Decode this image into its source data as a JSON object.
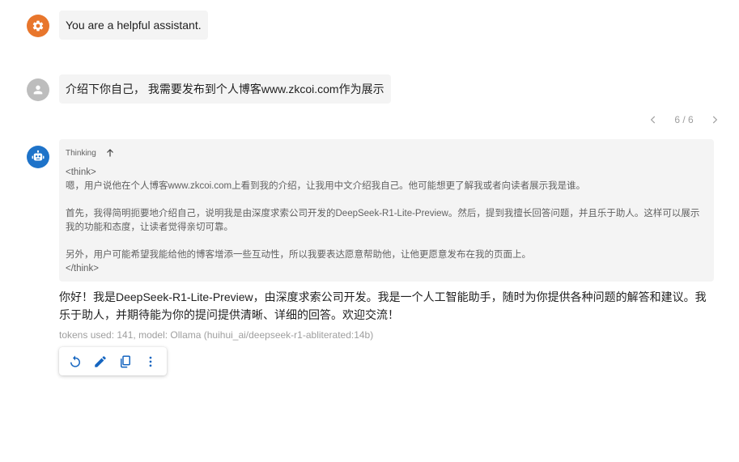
{
  "colors": {
    "system_avatar": "#e8762c",
    "user_avatar": "#bdbdbd",
    "assistant_avatar": "#1e73c9",
    "bubble_bg": "#f4f4f4",
    "icon_primary": "#1565c0"
  },
  "messages": {
    "system": {
      "avatar_icon": "gear-icon",
      "text": "You are a helpful assistant."
    },
    "user": {
      "avatar_icon": "person-icon",
      "text": "介绍下你自己， 我需要发布到个人博客www.zkcoi.com作为展示"
    },
    "assistant": {
      "avatar_icon": "robot-icon",
      "pager": {
        "label": "6 / 6"
      },
      "thinking": {
        "header": "Thinking",
        "toggle_icon": "arrow-up-icon",
        "lines": {
          "open_tag": "<think>",
          "p1": "嗯，用户说他在个人博客www.zkcoi.com上看到我的介绍，让我用中文介绍我自己。他可能想更了解我或者向读者展示我是谁。",
          "p2": "首先，我得简明扼要地介绍自己，说明我是由深度求索公司开发的DeepSeek-R1-Lite-Preview。然后，提到我擅长回答问题，并且乐于助人。这样可以展示我的功能和态度，让读者觉得亲切可靠。",
          "p3": "另外，用户可能希望我能给他的博客增添一些互动性，所以我要表达愿意帮助他，让他更愿意发布在我的页面上。",
          "close_tag": "</think>"
        }
      },
      "answer": "你好！我是DeepSeek-R1-Lite-Preview，由深度求索公司开发。我是一个人工智能助手，随时为你提供各种问题的解答和建议。我乐于助人，并期待能为你的提问提供清晰、详细的回答。欢迎交流！",
      "meta": "tokens used: 141, model: Ollama (huihui_ai/deepseek-r1-abliterated:14b)",
      "toolbar": {
        "icons": [
          "refresh-icon",
          "edit-icon",
          "copy-icon",
          "more-vert-icon"
        ]
      }
    }
  }
}
